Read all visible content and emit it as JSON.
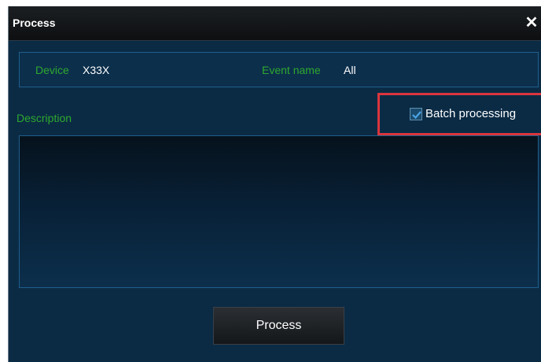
{
  "dialog": {
    "title": "Process",
    "close_icon": "close-icon"
  },
  "info": {
    "device_label": "Device",
    "device_value": "X33X",
    "event_label": "Event name",
    "event_value": "All"
  },
  "description": {
    "label": "Description",
    "value": ""
  },
  "batch": {
    "label": "Batch processing",
    "checked": true
  },
  "actions": {
    "process_label": "Process"
  },
  "colors": {
    "background": "#0b2b45",
    "label_green": "#2ea82e",
    "highlight_red": "#d9363e"
  }
}
